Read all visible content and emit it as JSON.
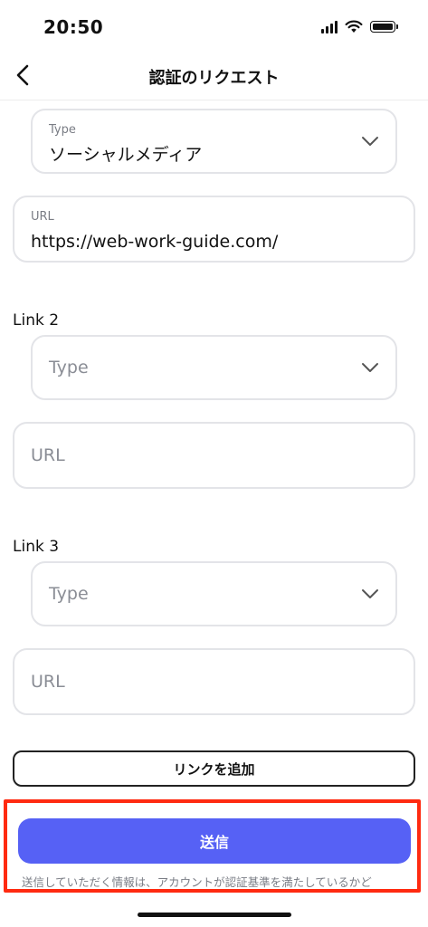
{
  "status_bar": {
    "time": "20:50"
  },
  "header": {
    "title": "認証のリクエスト"
  },
  "link1": {
    "type_label": "Type",
    "type_value": "ソーシャルメディア",
    "url_label": "URL",
    "url_value": "https://web-work-guide.com/"
  },
  "link2": {
    "label": "Link 2",
    "type_placeholder": "Type",
    "url_placeholder": "URL"
  },
  "link3": {
    "label": "Link 3",
    "type_placeholder": "Type",
    "url_placeholder": "URL"
  },
  "actions": {
    "add_link": "リンクを追加",
    "submit": "送信"
  },
  "footnote": "送信していただく情報は、アカウントが認証基準を満たしているかど",
  "colors": {
    "accent": "#5661f5",
    "highlight": "#ff2a10"
  }
}
